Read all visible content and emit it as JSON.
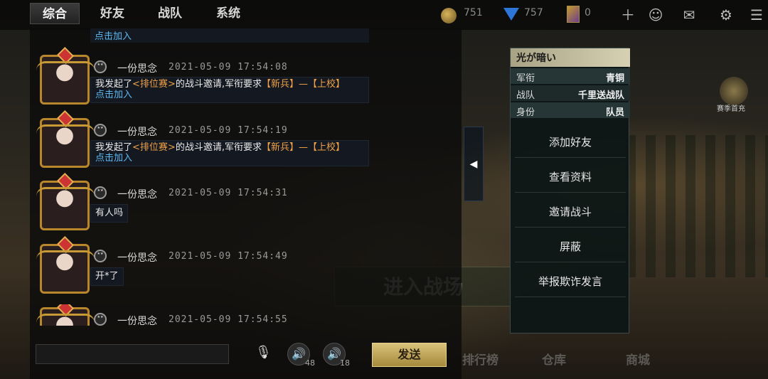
{
  "tabs": [
    {
      "label": "综合",
      "active": true
    },
    {
      "label": "好友",
      "active": false
    },
    {
      "label": "战队",
      "active": false
    },
    {
      "label": "系统",
      "active": false
    }
  ],
  "resources": {
    "coins": "751",
    "gems": "757",
    "cards": "0"
  },
  "chat": {
    "partial_top_text": "点击加入",
    "messages": [
      {
        "name": "一份思念",
        "time": "2021-05-09 17:54:08",
        "type": "invite",
        "line1_pre": "我发起了",
        "line1_mode": "<排位赛>",
        "line1_mid": "的战斗邀请,军衔要求",
        "line1_r1": "【新兵】",
        "line1_dash": "—",
        "line1_r2": "【上校】",
        "line2": "点击加入"
      },
      {
        "name": "一份思念",
        "time": "2021-05-09 17:54:19",
        "type": "invite",
        "line1_pre": "我发起了",
        "line1_mode": "<排位赛>",
        "line1_mid": "的战斗邀请,军衔要求",
        "line1_r1": "【新兵】",
        "line1_dash": "—",
        "line1_r2": "【上校】",
        "line2": "点击加入"
      },
      {
        "name": "一份思念",
        "time": "2021-05-09 17:54:31",
        "type": "text",
        "text": "有人吗"
      },
      {
        "name": "一份思念",
        "time": "2021-05-09 17:54:49",
        "type": "text",
        "text": "开*了"
      },
      {
        "name": "一份思念",
        "time": "2021-05-09 17:54:55",
        "type": "partial"
      }
    ]
  },
  "input": {
    "placeholder": ""
  },
  "voice": {
    "speaker1_count": "48",
    "speaker2_count": "18"
  },
  "send_label": "发送",
  "profile": {
    "name": "光が暗い",
    "rows": [
      {
        "key": "军衔",
        "value": "青铜"
      },
      {
        "key": "战队",
        "value": "千里送战队"
      },
      {
        "key": "身份",
        "value": "队员"
      }
    ],
    "actions": [
      "添加好友",
      "查看资料",
      "邀请战斗",
      "屏蔽",
      "举报欺诈发言"
    ]
  },
  "background": {
    "enter_label": "进入战场",
    "bottom_nav": [
      "排行榜",
      "仓库",
      "商城"
    ],
    "season_label": "赛季首充"
  },
  "colors": {
    "accent_gold": "#d9c27a",
    "highlight_orange": "#f0a146",
    "link_blue": "#5db8f0"
  }
}
